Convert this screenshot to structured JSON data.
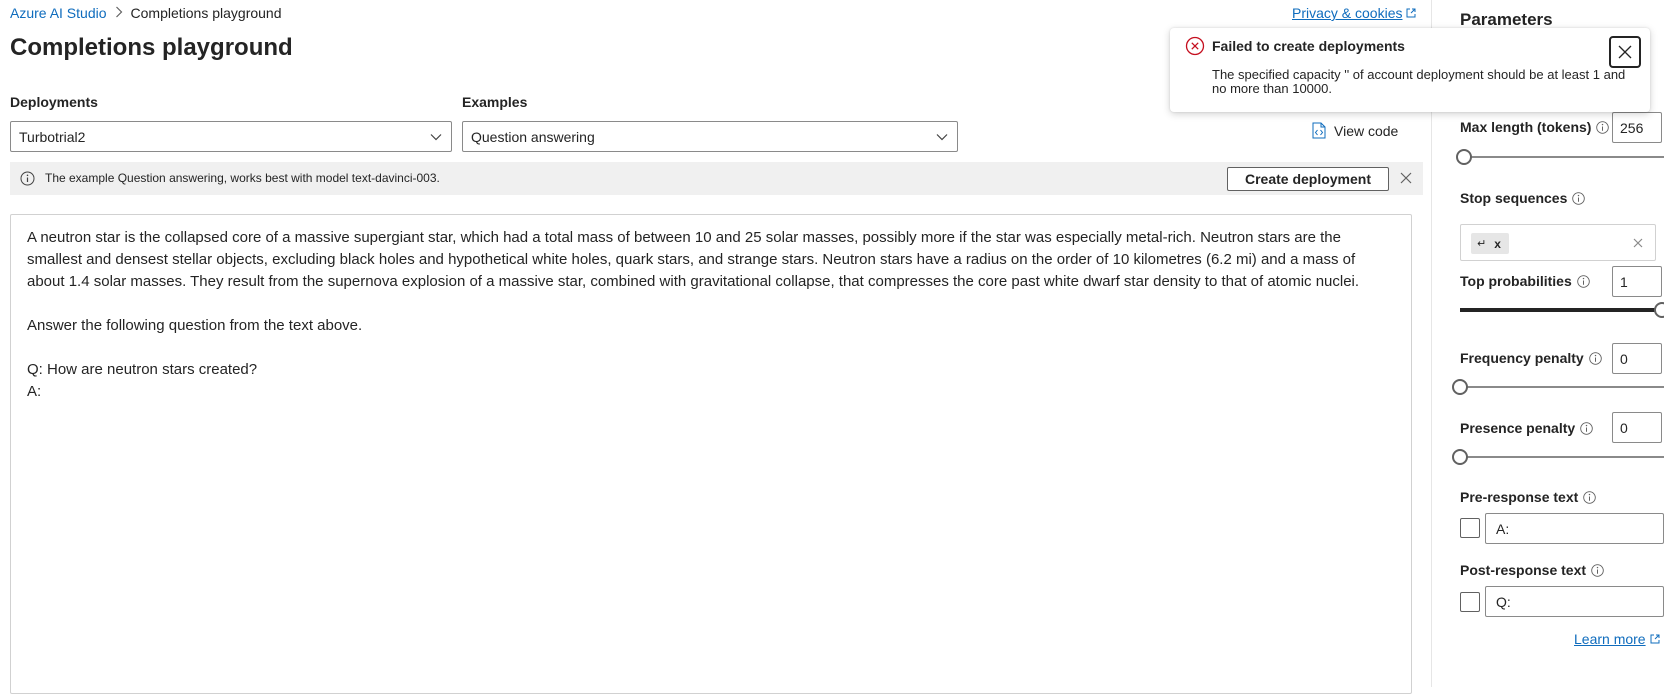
{
  "breadcrumb": {
    "root": "Azure AI Studio",
    "current": "Completions playground"
  },
  "header": {
    "privacy_link": "Privacy & cookies",
    "title": "Completions playground"
  },
  "deployments": {
    "label": "Deployments",
    "selected": "Turbotrial2"
  },
  "examples": {
    "label": "Examples",
    "selected": "Question answering"
  },
  "view_code": {
    "label": "View code",
    "icon": "code-file-icon"
  },
  "info_bar": {
    "text": "The example Question answering, works best with model text-davinci-003.",
    "create_button": "Create deployment",
    "icon": "info-icon"
  },
  "prompt": {
    "text": "A neutron star is the collapsed core of a massive supergiant star, which had a total mass of between 10 and 25 solar masses, possibly more if the star was especially metal-rich. Neutron stars are the smallest and densest stellar objects, excluding black holes and hypothetical white holes, quark stars, and strange stars. Neutron stars have a radius on the order of 10 kilometres (6.2 mi) and a mass of about 1.4 solar masses. They result from the supernova explosion of a massive star, combined with gravitational collapse, that compresses the core past white dwarf star density to that of atomic nuclei.\n\nAnswer the following question from the text above.\n\nQ: How are neutron stars created?\nA:"
  },
  "parameters": {
    "title": "Parameters",
    "max_length": {
      "label": "Max length (tokens)",
      "value": "256",
      "slider_fraction": 0.02
    },
    "stop_sequences": {
      "label": "Stop sequences",
      "chip": "↵",
      "chip_remove": "x"
    },
    "top_probabilities": {
      "label": "Top probabilities",
      "value": "1",
      "slider_fraction": 1.0
    },
    "frequency_penalty": {
      "label": "Frequency penalty",
      "value": "0",
      "slider_fraction": 0.0
    },
    "presence_penalty": {
      "label": "Presence penalty",
      "value": "0",
      "slider_fraction": 0.0
    },
    "pre_response": {
      "label": "Pre-response text",
      "value": "A:",
      "checked": false
    },
    "post_response": {
      "label": "Post-response text",
      "value": "Q:",
      "checked": false
    },
    "learn_more": "Learn more"
  },
  "toast": {
    "title": "Failed to create deployments",
    "message": "The specified capacity '' of account deployment should be at least 1 and no more than 10000.",
    "icon": "error-circle-icon"
  },
  "colors": {
    "link": "#0f6cbd",
    "error": "#c50f1f",
    "text": "#242424"
  }
}
